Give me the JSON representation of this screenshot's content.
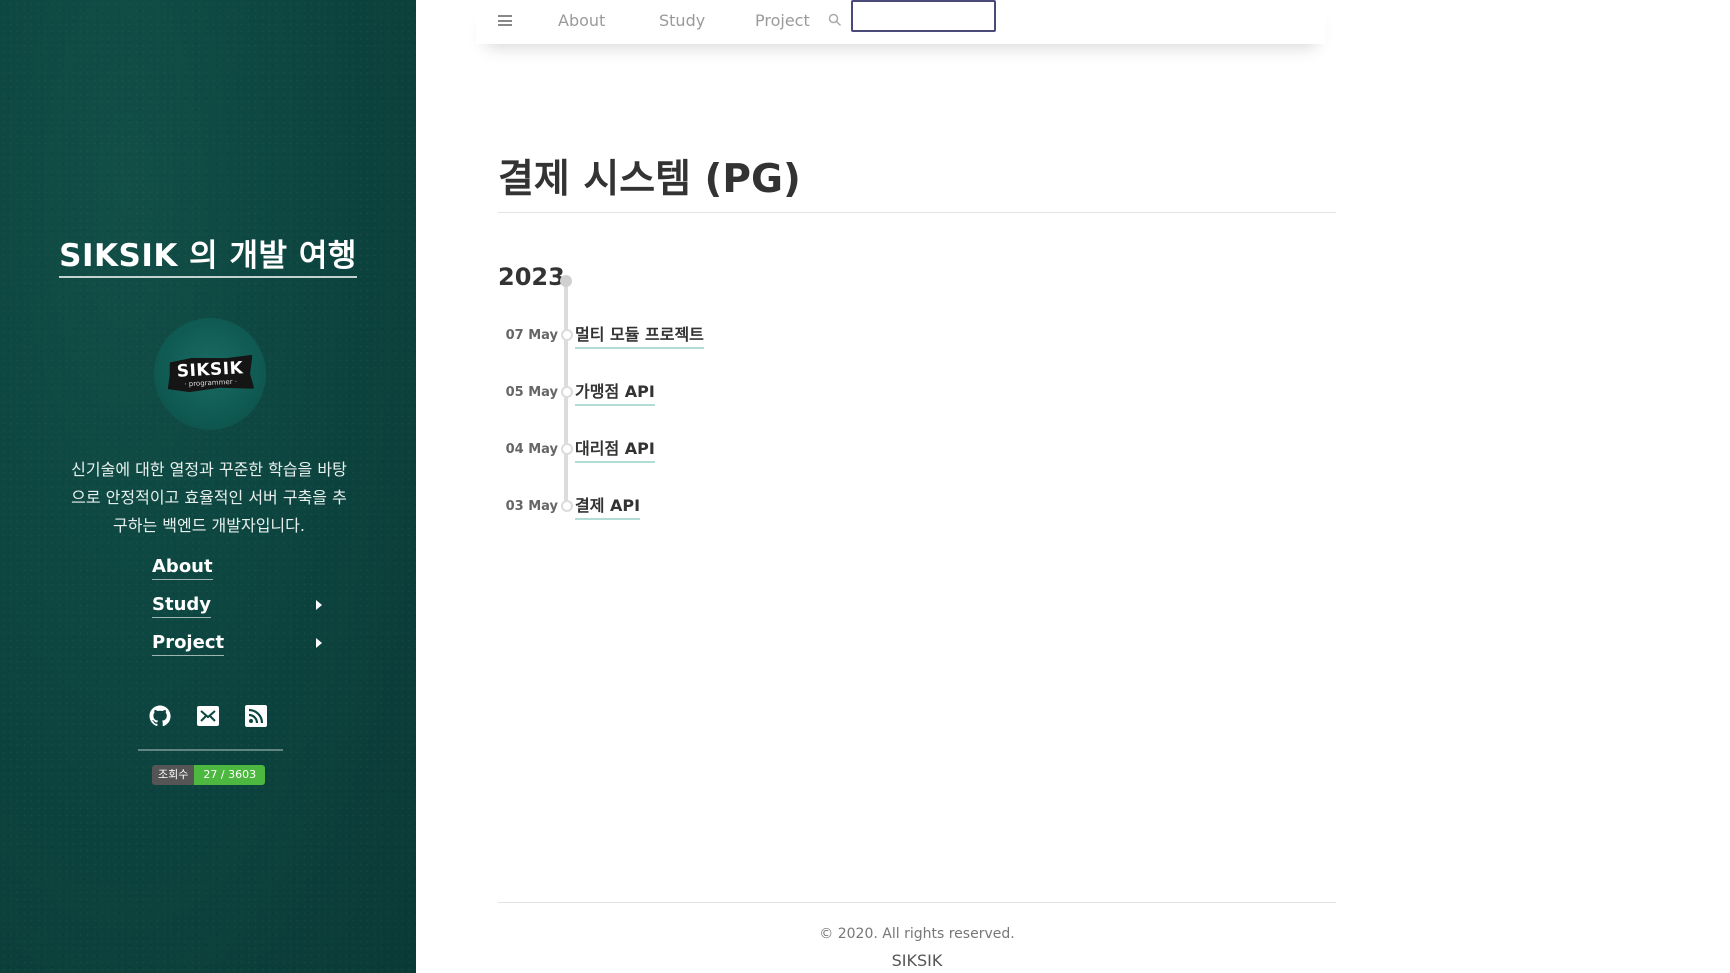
{
  "sidebar": {
    "title": "SIKSIK 의 개발 여행",
    "avatar": {
      "name": "SIKSIK",
      "sub": "· programmer ·"
    },
    "bio": "신기술에 대한 열정과 꾸준한 학습을 바탕으로 안정적이고 효율적인 서버 구축을 추구하는 백엔드 개발자입니다.",
    "nav": [
      {
        "label": "About",
        "has_submenu": false
      },
      {
        "label": "Study",
        "has_submenu": true
      },
      {
        "label": "Project",
        "has_submenu": true
      }
    ],
    "social_icons": [
      "github-icon",
      "mail-icon",
      "rss-icon"
    ],
    "hits_badge": {
      "label": "조회수",
      "value": "27 / 3603"
    }
  },
  "topbar": {
    "links": [
      "About",
      "Study",
      "Project"
    ],
    "search_value": ""
  },
  "main": {
    "title": "결제 시스템 (PG)",
    "year": "2023",
    "posts": [
      {
        "date": "07 May",
        "title": "멀티 모듈 프로젝트"
      },
      {
        "date": "05 May",
        "title": "가맹점 API"
      },
      {
        "date": "04 May",
        "title": "대리점 API"
      },
      {
        "date": "03 May",
        "title": "결제 API"
      }
    ]
  },
  "footer": {
    "copyright": "© 2020. All rights reserved.",
    "name": "SIKSIK"
  }
}
